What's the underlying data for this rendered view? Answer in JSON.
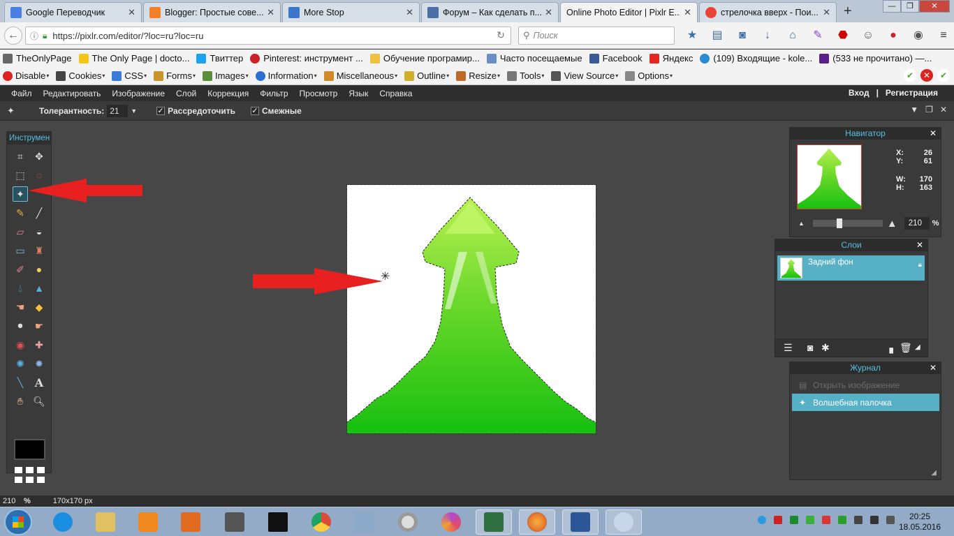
{
  "browser": {
    "tabs": [
      {
        "title": "Google Переводчик",
        "color": "#4a7fe6",
        "active": false
      },
      {
        "title": "Blogger: Простые сове...",
        "color": "#f5802a",
        "active": false
      },
      {
        "title": "More Stop",
        "color": "#3a77c9",
        "active": false
      },
      {
        "title": "Форум – Как сделать п...",
        "color": "#4a6fa5",
        "active": false
      },
      {
        "title": "Online Photo Editor | Pixlr E...",
        "color": "#ffffff",
        "active": true
      },
      {
        "title": "стрелочка вверх - Пои...",
        "color": "#ea4335",
        "active": false
      }
    ],
    "url": "https://pixlr.com/editor/?loc=ru?loc=ru",
    "search_placeholder": "Поиск",
    "bookmarks": [
      {
        "label": "TheOnlyPage",
        "color": "#666666"
      },
      {
        "label": "The Only Page | docto...",
        "color": "#f5c518"
      },
      {
        "label": "Твиттер",
        "color": "#1da1f2"
      },
      {
        "label": "Pinterest: инструмент ...",
        "color": "#cb2027"
      },
      {
        "label": "Обучение програмир...",
        "color": "#f0c040"
      },
      {
        "label": "Часто посещаемые",
        "color": "#6b8fc4"
      },
      {
        "label": "Facebook",
        "color": "#3b5998"
      },
      {
        "label": "Яндекс",
        "color": "#e52620"
      },
      {
        "label": "(109) Входящие - kole...",
        "color": "#2a8dd4"
      },
      {
        "label": "(533 не прочитано) —...",
        "color": "#5b1f8a"
      }
    ],
    "devtools": [
      {
        "label": "Disable",
        "color": "#d22"
      },
      {
        "label": "Cookies",
        "color": "#444"
      },
      {
        "label": "CSS",
        "color": "#3a7bd5"
      },
      {
        "label": "Forms",
        "color": "#c8962b"
      },
      {
        "label": "Images",
        "color": "#5a8f3a"
      },
      {
        "label": "Information",
        "color": "#2a6fd0"
      },
      {
        "label": "Miscellaneous",
        "color": "#d08a2a"
      },
      {
        "label": "Outline",
        "color": "#d0b02a"
      },
      {
        "label": "Resize",
        "color": "#c06a2a"
      },
      {
        "label": "Tools",
        "color": "#777"
      },
      {
        "label": "View Source",
        "color": "#555"
      },
      {
        "label": "Options",
        "color": "#888"
      }
    ]
  },
  "menu": {
    "items": [
      "Файл",
      "Редактировать",
      "Изображение",
      "Слой",
      "Коррекция",
      "Фильтр",
      "Просмотр",
      "Язык",
      "Справка"
    ],
    "login": "Вход",
    "separator": "|",
    "register": "Регистрация"
  },
  "options": {
    "tolerance_label": "Толерантность:",
    "tolerance_value": "21",
    "antialias_label": "Рассредоточить",
    "contiguous_label": "Смежные"
  },
  "toolbox": {
    "title": "Инструмен",
    "tools": [
      "crop-icon",
      "move-icon",
      "marquee-icon",
      "lasso-icon",
      "magic-wand-icon",
      "pencil-icon",
      "brush-icon",
      "eraser-icon",
      "bucket-icon",
      "gradient-icon",
      "clone-stamp-icon",
      "color-replace-icon",
      "shapes-icon",
      "blur-icon",
      "sharpen-icon",
      "smudge-icon",
      "sponge-icon",
      "burn-icon",
      "dodge-icon",
      "red-eye-icon",
      "spot-heal-icon",
      "bloat-icon",
      "pinch-icon",
      "eyedropper-icon",
      "text-icon",
      "hand-icon",
      "zoom-icon"
    ],
    "selected": "magic-wand-icon",
    "foreground_color": "#000000"
  },
  "navigator": {
    "title": "Навигатор",
    "x_label": "X:",
    "x_value": "26",
    "y_label": "Y:",
    "y_value": "61",
    "w_label": "W:",
    "w_value": "170",
    "h_label": "H:",
    "h_value": "163",
    "zoom_value": "210",
    "zoom_unit": "%"
  },
  "layers": {
    "title": "Слои",
    "items": [
      {
        "name": "Задний фон",
        "locked": true
      }
    ]
  },
  "history": {
    "title": "Журнал",
    "items": [
      {
        "label": "Открыть изображение",
        "active": false
      },
      {
        "label": "Волшебная палочка",
        "active": true
      }
    ]
  },
  "status": {
    "zoom": "210",
    "zoom_unit": "%",
    "size": "170x170 px"
  },
  "taskbar": {
    "apps": [
      {
        "name": "internet-explorer",
        "color": "#1a8ee0",
        "open": false
      },
      {
        "name": "file-explorer",
        "color": "#e0c060",
        "open": false
      },
      {
        "name": "media-player",
        "color": "#f08a20",
        "open": false
      },
      {
        "name": "toolbox-app",
        "color": "#e06a20",
        "open": false
      },
      {
        "name": "sublime-text",
        "color": "#555555",
        "open": false
      },
      {
        "name": "command-prompt",
        "color": "#111111",
        "open": false
      },
      {
        "name": "chrome",
        "color": "#dd4b39",
        "open": false
      },
      {
        "name": "calculator",
        "color": "#8aa8c8",
        "open": false
      },
      {
        "name": "opera",
        "color": "#cccccc",
        "open": false
      },
      {
        "name": "app-swirl",
        "color": "#b04ad0",
        "open": false
      },
      {
        "name": "task-manager",
        "color": "#2f6f3f",
        "open": true
      },
      {
        "name": "firefox",
        "color": "#e8762b",
        "open": true
      },
      {
        "name": "word",
        "color": "#2b5797",
        "open": true
      },
      {
        "name": "paint",
        "color": "#c8d8e8",
        "open": true
      }
    ],
    "time": "20:25",
    "date": "18.05.2016"
  }
}
